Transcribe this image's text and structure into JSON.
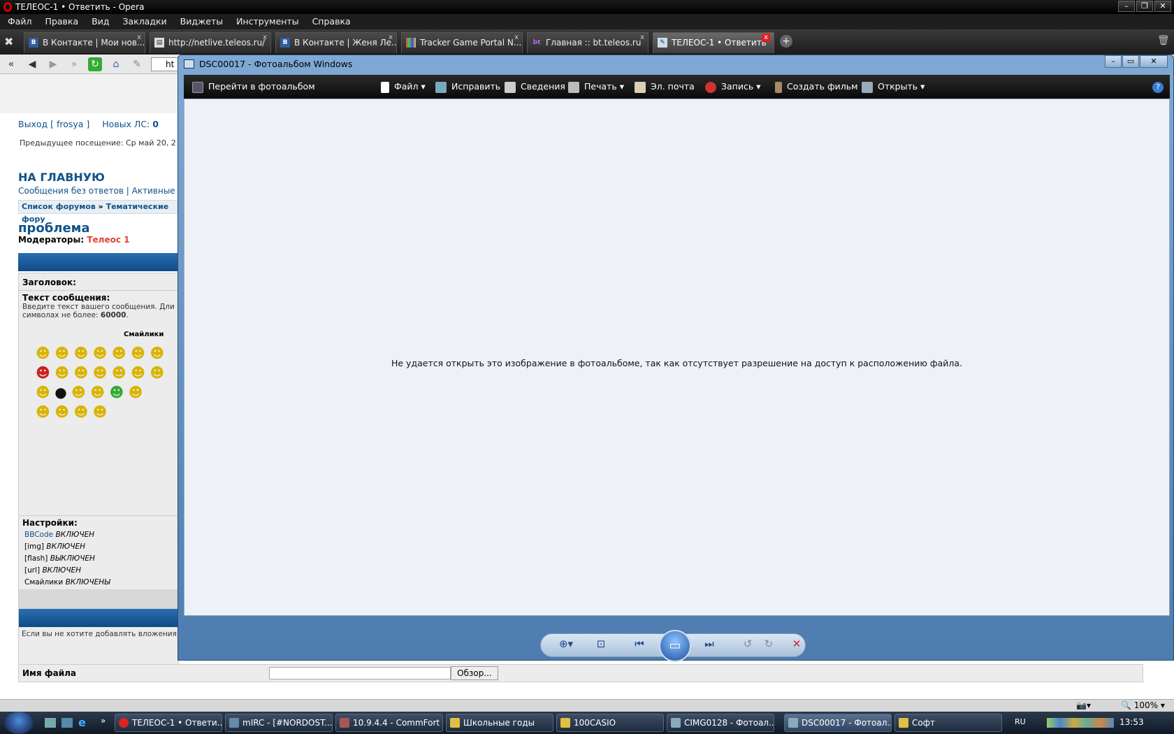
{
  "browser": {
    "title": "ТЕЛЕОС-1 • Ответить - Opera",
    "menu": [
      "Файл",
      "Правка",
      "Вид",
      "Закладки",
      "Виджеты",
      "Инструменты",
      "Справка"
    ],
    "tabs": [
      {
        "label": "В Контакте | Мои нов...",
        "icon": "vk-icon"
      },
      {
        "label": "http://netlive.teleos.ru/",
        "icon": "page-icon"
      },
      {
        "label": "В Контакте | Женя Ле...",
        "icon": "vk-icon"
      },
      {
        "label": "Tracker Game Portal N...",
        "icon": "tracker-icon"
      },
      {
        "label": "Главная :: bt.teleos.ru",
        "icon": "bt-icon"
      },
      {
        "label": "ТЕЛЕОС-1 • Ответить",
        "icon": "forum-icon"
      }
    ],
    "address_prefix": "ht"
  },
  "forum": {
    "logout": "Выход [ frosya ]",
    "new_pm_label": "Новых ЛС:",
    "new_pm_count": "0",
    "last_visit": "Предыдущее посещение: Ср май 20, 2",
    "home_link": "НА ГЛАВНУЮ",
    "links": "Сообщения без ответов | Активные те",
    "breadcrumb_1": "Список форумов",
    "breadcrumb_sep": "»",
    "breadcrumb_2": "Тематические фору",
    "topic_title": "проблема",
    "moderators_label": "Модераторы:",
    "moderator": "Телеос 1",
    "subject_label": "Заголовок:",
    "message_label": "Текст сообщения:",
    "message_hint_1": "Введите текст вашего сообщения. Дли",
    "message_hint_2": "символах не более:",
    "message_hint_limit": "60000",
    "smileys_label": "Смайлики",
    "settings_label": "Настройки:",
    "settings": [
      {
        "name": "BBCode",
        "state": "ВКЛЮЧЕН"
      },
      {
        "name": "[img]",
        "state": "ВКЛЮЧЕН"
      },
      {
        "name": "[flash]",
        "state": "ВЫКЛЮЧЕН"
      },
      {
        "name": "[url]",
        "state": "ВКЛЮЧЕН"
      },
      {
        "name": "Смайлики",
        "state": "ВКЛЮЧЕНЫ"
      }
    ],
    "attach_hint": "Если вы не хотите добавлять вложения",
    "filename_label": "Имя файла",
    "browse_button": "Обзор..."
  },
  "photo_viewer": {
    "title": "DSC00017 - Фотоальбом Windows",
    "toolbar": {
      "goto_album": "Перейти в фотоальбом",
      "file": "Файл",
      "fix": "Исправить",
      "info": "Сведения",
      "print": "Печать",
      "email": "Эл. почта",
      "burn": "Запись",
      "make_movie": "Создать фильм",
      "open": "Открыть"
    },
    "message": "Не удается открыть это изображение в фотоальбоме, так как отсутствует разрешение на доступ к расположению файла."
  },
  "statusbar": {
    "zoom": "100%"
  },
  "taskbar": {
    "items": [
      {
        "label": "ТЕЛЕОС-1 • Ответи...",
        "icon": "opera-icon"
      },
      {
        "label": "mIRC - [#NORDOST...",
        "icon": "mirc-icon"
      },
      {
        "label": "10.9.4.4 - CommFort",
        "icon": "commfort-icon"
      },
      {
        "label": "Школьные годы",
        "icon": "folder-icon"
      },
      {
        "label": "100CASIO",
        "icon": "folder-icon"
      },
      {
        "label": "CIMG0128 - Фотоал...",
        "icon": "photo-icon"
      },
      {
        "label": "DSC00017 - Фотоал...",
        "icon": "photo-icon"
      },
      {
        "label": "Софт",
        "icon": "folder-icon"
      }
    ],
    "lang": "RU",
    "clock": "13:53"
  },
  "colors": {
    "link": "#105289",
    "moderator": "#e0413a",
    "viewer_bg": "#eef2f8",
    "toolbar": "#0a0a0a"
  }
}
